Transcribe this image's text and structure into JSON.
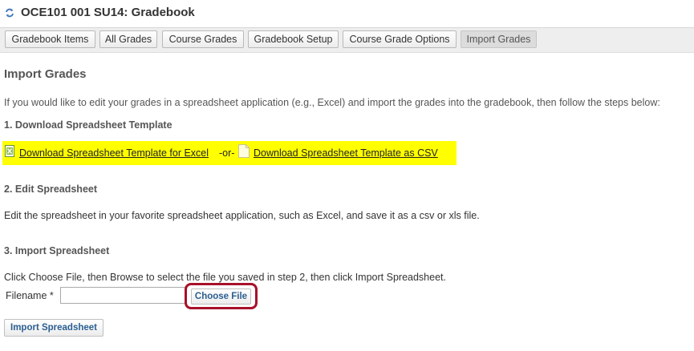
{
  "header": {
    "title": "OCE101 001 SU14: Gradebook"
  },
  "nav": {
    "tabs": [
      {
        "label": "Gradebook Items"
      },
      {
        "label": "All Grades"
      },
      {
        "label": "Course Grades"
      },
      {
        "label": "Gradebook Setup"
      },
      {
        "label": "Course Grade Options"
      },
      {
        "label": "Import Grades"
      }
    ],
    "active": "Import Grades"
  },
  "page": {
    "heading": "Import Grades",
    "intro": "If you would like to edit your grades in a spreadsheet application (e.g., Excel) and import the grades into the gradebook, then follow the steps below:"
  },
  "step1": {
    "title": "1. Download Spreadsheet Template",
    "excel_link": "Download Spreadsheet Template for Excel",
    "or_text": "-or-",
    "csv_link": "Download Spreadsheet Template as CSV",
    "highlight_color": "#ffff00"
  },
  "step2": {
    "title": "2. Edit Spreadsheet",
    "text": "Edit the spreadsheet in your favorite spreadsheet application, such as Excel, and save it as a csv or xls file."
  },
  "step3": {
    "title": "3. Import Spreadsheet",
    "text": "Click Choose File, then Browse to select the file you saved in step 2, then click Import Spreadsheet.",
    "filename_label": "Filename *",
    "filename_value": "",
    "choose_file_label": "Choose File",
    "annotation_color": "#a8102a"
  },
  "actions": {
    "import_label": "Import Spreadsheet"
  }
}
